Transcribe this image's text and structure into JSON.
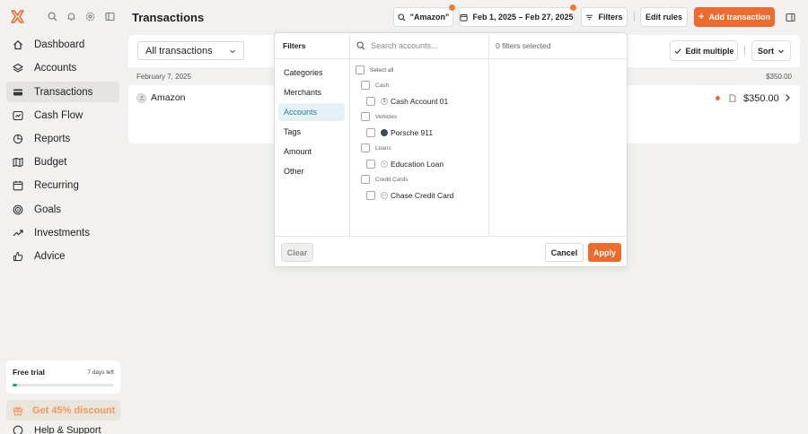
{
  "sidebar": {
    "items": [
      {
        "label": "Dashboard",
        "icon": "home-icon"
      },
      {
        "label": "Accounts",
        "icon": "layers-icon"
      },
      {
        "label": "Transactions",
        "icon": "card-icon"
      },
      {
        "label": "Cash Flow",
        "icon": "cashflow-icon"
      },
      {
        "label": "Reports",
        "icon": "pie-icon"
      },
      {
        "label": "Budget",
        "icon": "map-icon"
      },
      {
        "label": "Recurring",
        "icon": "calendar-icon"
      },
      {
        "label": "Goals",
        "icon": "target-icon"
      },
      {
        "label": "Investments",
        "icon": "trend-icon"
      },
      {
        "label": "Advice",
        "icon": "thumbs-up-icon"
      }
    ],
    "trial": {
      "title": "Free trial",
      "days_left": "7 days left",
      "progress": 0.04
    },
    "discount_label": "Get 45% discount",
    "help_label": "Help & Support"
  },
  "header": {
    "title": "Transactions",
    "search_chip": "\"Amazon\"",
    "date_range": "Feb 1, 2025 – Feb 27, 2025",
    "filters_label": "Filters",
    "edit_rules_label": "Edit rules",
    "add_label": "Add transaction"
  },
  "list": {
    "select_value": "All transactions",
    "edit_multiple_label": "Edit multiple",
    "sort_label": "Sort",
    "date_group": "February 7, 2025",
    "group_total": "$350.00",
    "transactions": [
      {
        "merchant": "Amazon",
        "amount": "$350.00"
      }
    ]
  },
  "filters_popover": {
    "header": "Filters",
    "categories": [
      "Categories",
      "Merchants",
      "Accounts",
      "Tags",
      "Amount",
      "Other"
    ],
    "active_category": "Accounts",
    "search_placeholder": "Search accounts...",
    "selected_count_label": "0 filters selected",
    "select_all_label": "Select all",
    "groups": [
      {
        "name": "Cash",
        "accounts": [
          "Cash Account 01"
        ]
      },
      {
        "name": "Vehicles",
        "accounts": [
          "Porsche 911"
        ]
      },
      {
        "name": "Loans",
        "accounts": [
          "Education Loan"
        ]
      },
      {
        "name": "Credit Cards",
        "accounts": [
          "Chase Credit Card"
        ]
      }
    ],
    "clear_label": "Clear",
    "cancel_label": "Cancel",
    "apply_label": "Apply"
  },
  "colors": {
    "accent": "#ee6b2f",
    "active_filter": "#2e7d9b",
    "positive": "#27a36b"
  }
}
